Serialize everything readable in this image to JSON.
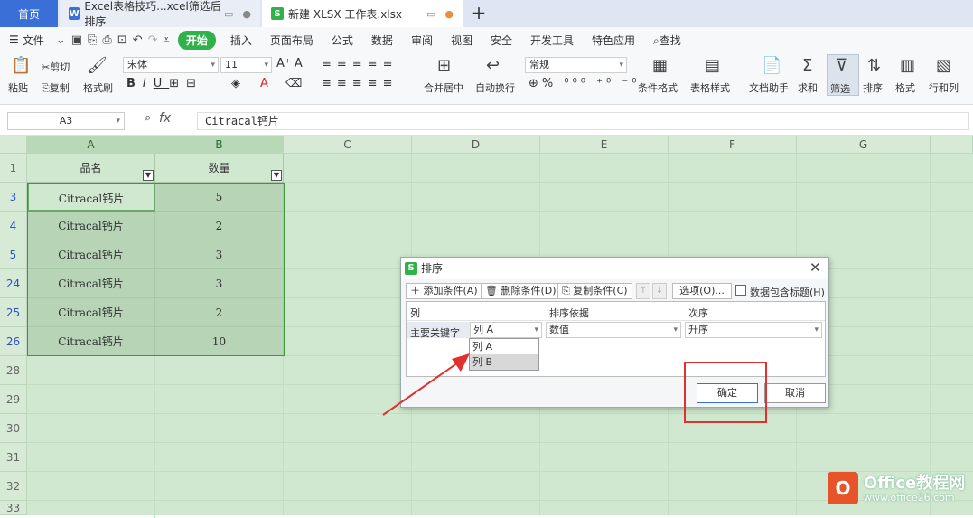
{
  "tabs": {
    "home": "首页",
    "doc": "Excel表格技巧...xcel筛选后排序",
    "new": "新建 XLSX 工作表.xlsx",
    "plus": "+"
  },
  "menu": {
    "file": "文件",
    "items": [
      "开始",
      "插入",
      "页面布局",
      "公式",
      "数据",
      "审阅",
      "视图",
      "安全",
      "开发工具",
      "特色应用"
    ],
    "search": "查找"
  },
  "ribbon": {
    "paste": "粘贴",
    "cut": "剪切",
    "copy": "复制",
    "format_painter": "格式刷",
    "font": "宋体",
    "size": "11",
    "merge": "合并居中",
    "wrap": "自动换行",
    "numfmt": "常规",
    "cond_format": "条件格式",
    "table_style": "表格样式",
    "doc_assist": "文档助手",
    "sum": "求和",
    "filter": "筛选",
    "sort": "排序",
    "format": "格式",
    "rowcol": "行和列"
  },
  "formula_bar": {
    "namebox": "A3",
    "fx": "fx",
    "content": "Citracal钙片"
  },
  "sheet": {
    "columns": [
      "A",
      "B",
      "C",
      "D",
      "E",
      "F",
      "G"
    ],
    "rows": [
      "1",
      "3",
      "4",
      "5",
      "24",
      "25",
      "26",
      "28",
      "29",
      "30",
      "31",
      "32",
      "33"
    ],
    "header": {
      "a": "品名",
      "b": "数量"
    },
    "data": [
      {
        "name": "Citracal钙片",
        "qty": "5"
      },
      {
        "name": "Citracal钙片",
        "qty": "2"
      },
      {
        "name": "Citracal钙片",
        "qty": "3"
      },
      {
        "name": "Citracal钙片",
        "qty": "3"
      },
      {
        "name": "Citracal钙片",
        "qty": "2"
      },
      {
        "name": "Citracal钙片",
        "qty": "10"
      }
    ]
  },
  "dialog": {
    "title": "排序",
    "add": "添加条件(A)",
    "delete": "删除条件(D)",
    "copy": "复制条件(C)",
    "options": "选项(O)...",
    "has_header": "数据包含标题(H)",
    "col_header": "列",
    "basis_header": "排序依据",
    "order_header": "次序",
    "key_label": "主要关键字",
    "key_value": "列 A",
    "basis_value": "数值",
    "order_value": "升序",
    "options_list": [
      "列 A",
      "列 B"
    ],
    "ok": "确定",
    "cancel": "取消"
  },
  "watermark": {
    "brand": "Office教程网",
    "url": "www.office26.com"
  }
}
